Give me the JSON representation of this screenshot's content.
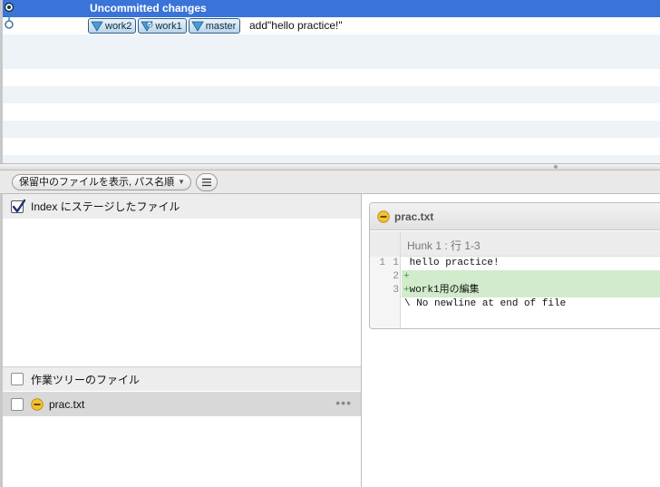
{
  "history": {
    "uncommitted_label": "Uncommitted changes",
    "commit": {
      "refs": [
        {
          "name": "work2"
        },
        {
          "name": "work1"
        },
        {
          "name": "master"
        }
      ],
      "message": "add\"hello practice!\""
    },
    "colors": {
      "selected_row": "#3a74d8",
      "alt_row": "#eef3f8",
      "graph_node": "#3b7fb6"
    }
  },
  "toolbar": {
    "sort_select_value": "保留中のファイルを表示, パス名順",
    "view_icon": "list-icon"
  },
  "index": {
    "label": "Index にステージしたファイル",
    "checked": true
  },
  "working_tree": {
    "label": "作業ツリーのファイル",
    "checked": false,
    "files": [
      {
        "name": "prac.txt",
        "status_icon": "modified-face-icon",
        "checked": false
      }
    ]
  },
  "diff": {
    "file_name": "prac.txt",
    "hunk_header": "Hunk 1 : 行 1-3",
    "lines": [
      {
        "old": "1",
        "new": "1",
        "type": "context",
        "prefix": " ",
        "text": "hello practice!"
      },
      {
        "old": "",
        "new": "2",
        "type": "add",
        "prefix": "+",
        "text": ""
      },
      {
        "old": "",
        "new": "3",
        "type": "add",
        "prefix": "+",
        "text": "work1用の編集"
      },
      {
        "old": "",
        "new": "",
        "type": "note",
        "prefix": "\\",
        "text": " No newline at end of file"
      }
    ],
    "colors": {
      "added": "#d2ebcc"
    }
  }
}
